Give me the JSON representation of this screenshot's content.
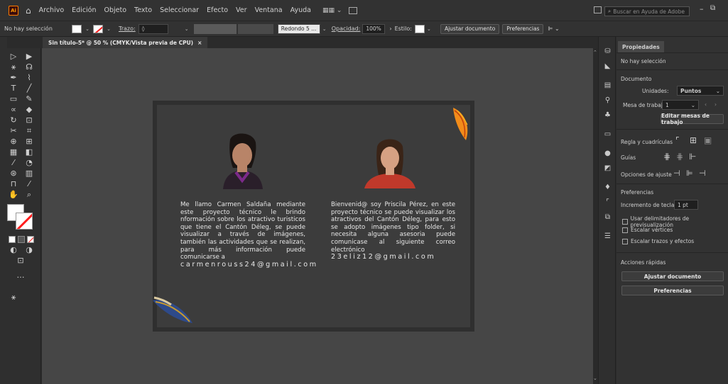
{
  "app": {
    "logo": "Ai",
    "menu": [
      "Archivo",
      "Edición",
      "Objeto",
      "Texto",
      "Seleccionar",
      "Efecto",
      "Ver",
      "Ventana",
      "Ayuda"
    ],
    "search_placeholder": "Buscar en Ayuda de Adobe"
  },
  "control": {
    "selection": "No hay selección",
    "stroke_label": "Trazo:",
    "brush": "Redondo 5 ...",
    "opacity_label": "Opacidad:",
    "opacity_value": "100%",
    "style_label": "Estilo:",
    "adjust_doc": "Ajustar documento",
    "preferences": "Preferencias"
  },
  "document": {
    "tab_title": "Sin título-5* @ 50 % (CMYK/Vista previa de CPU)",
    "close_glyph": "×"
  },
  "artboard": {
    "bio_left": "Me llamo Carmen Saldaña mediante este proyecto técnico le brindo nformación sobre los atractivo turisticos que tiene el Cantón Déleg, se puede visualizar a través de imágenes, también las actividades que se realizan, para más información puede comunicarse a",
    "email_left": "carmenrouss24@gmail.com",
    "bio_right": "Bienvenid@ soy Priscila Pérez, en este proyecto técnico se puede visualizar los atractivos del Cantón Déleg, para esto se adopto imágenes tipo folder, si necesita alguna asesoria puede comunicase al siguiente correo electrónico",
    "email_right": "23eliz12@gmail.com"
  },
  "properties": {
    "tab": "Propiedades",
    "no_selection": "No hay selección",
    "document_label": "Documento",
    "units_label": "Unidades:",
    "units_value": "Puntos",
    "artboard_label": "Mesa de trabajo:",
    "artboard_value": "1",
    "edit_artboards": "Editar mesas de trabajo",
    "rulers_label": "Regla y cuadrículas",
    "guides_label": "Guías",
    "snap_label": "Opciones de ajuste",
    "prefs_label": "Preferencias",
    "keyboard_inc_label": "Incremento de teclado:",
    "keyboard_inc_value": "1 pt",
    "chk_preview": "Usar delimitadores de previsualización",
    "chk_corners": "Escalar vértices",
    "chk_strokes": "Escalar trazos y efectos",
    "quick_actions": "Acciones rápidas",
    "adjust_doc": "Ajustar documento",
    "preferences": "Preferencias"
  },
  "colors": {
    "accent_orange": "#ff9a00",
    "stroke_red": "#ff1e1e"
  }
}
